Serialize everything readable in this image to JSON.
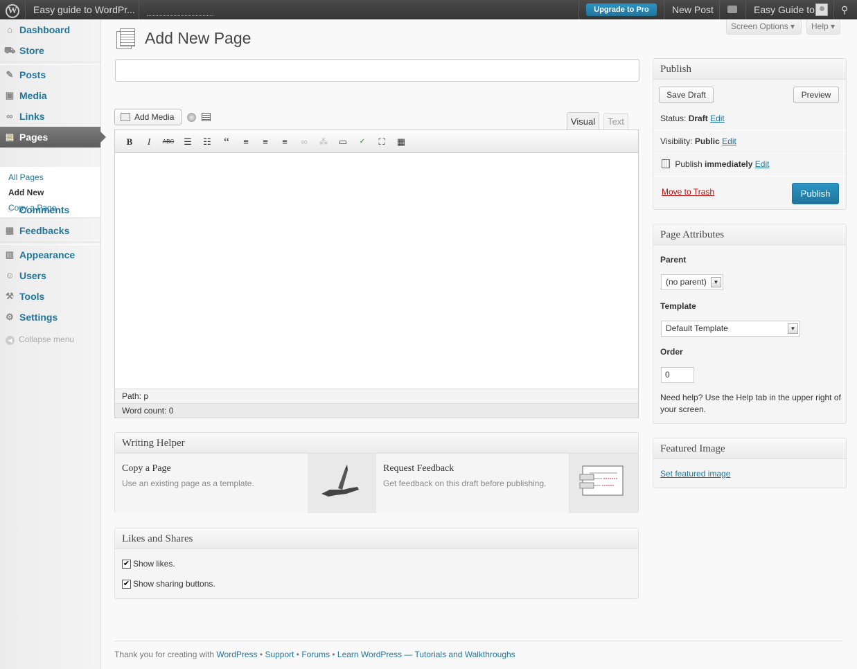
{
  "adminbar": {
    "site_name": "Easy guide to WordPr...",
    "upgrade": "Upgrade to Pro",
    "new_post": "New Post",
    "howdy": "Easy Guide to"
  },
  "sidebar": {
    "dashboard": "Dashboard",
    "store": "Store",
    "posts": "Posts",
    "media": "Media",
    "links": "Links",
    "pages": "Pages",
    "sub_all": "All Pages",
    "sub_add": "Add New",
    "sub_copy": "Copy a Page",
    "comments": "Comments",
    "feedbacks": "Feedbacks",
    "appearance": "Appearance",
    "users": "Users",
    "tools": "Tools",
    "settings": "Settings",
    "collapse": "Collapse menu"
  },
  "header": {
    "screen_options": "Screen Options ▾",
    "help": "Help ▾",
    "title": "Add New Page"
  },
  "editor": {
    "title_value": "",
    "add_media": "Add Media",
    "tab_visual": "Visual",
    "tab_text": "Text",
    "path": "Path: p",
    "word_count": "Word count: 0",
    "toolbar_icons": [
      "bold-icon",
      "italic-icon",
      "strikethrough-icon",
      "bullet-list-icon",
      "numbered-list-icon",
      "blockquote-icon",
      "align-left-icon",
      "align-center-icon",
      "align-right-icon",
      "link-icon",
      "unlink-icon",
      "more-tag-icon",
      "spellcheck-icon",
      "fullscreen-icon",
      "kitchen-sink-icon"
    ]
  },
  "writing_helper": {
    "heading": "Writing Helper",
    "copy_title": "Copy a Page",
    "copy_desc": "Use an existing page as a template.",
    "feedback_title": "Request Feedback",
    "feedback_desc": "Get feedback on this draft before publishing."
  },
  "likes": {
    "heading": "Likes and Shares",
    "show_likes": "Show likes.",
    "show_sharing": "Show sharing buttons.",
    "likes_checked": true,
    "sharing_checked": true
  },
  "publish": {
    "heading": "Publish",
    "save_draft": "Save Draft",
    "preview": "Preview",
    "status_label": "Status:",
    "status_value": "Draft",
    "visibility_label": "Visibility:",
    "visibility_value": "Public",
    "publish_label": "Publish",
    "publish_value": "immediately",
    "edit": "Edit",
    "trash": "Move to Trash",
    "publish_button": "Publish"
  },
  "attributes": {
    "heading": "Page Attributes",
    "parent_label": "Parent",
    "parent_value": "(no parent)",
    "template_label": "Template",
    "template_value": "Default Template",
    "order_label": "Order",
    "order_value": "0",
    "help": "Need help? Use the Help tab in the upper right of your screen."
  },
  "featured": {
    "heading": "Featured Image",
    "link": "Set featured image"
  },
  "footer": {
    "prefix": "Thank you for creating with",
    "wordpress": "WordPress",
    "sep": " • ",
    "support": "Support",
    "forums": "Forums",
    "learn": "Learn WordPress — Tutorials and Walkthroughs"
  },
  "colors": {
    "link": "#21759b",
    "primary_button": "#21759b",
    "trash": "#bc0b0b"
  }
}
